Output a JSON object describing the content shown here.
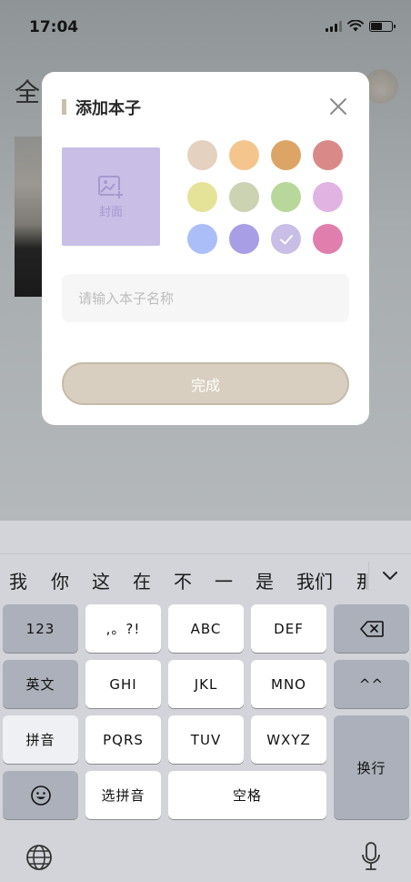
{
  "status_bar": {
    "time": "17:04"
  },
  "background": {
    "title": "全"
  },
  "modal": {
    "title": "添加本子",
    "cover_label": "封面",
    "colors": [
      {
        "hex": "#e5d1c0",
        "selected": false
      },
      {
        "hex": "#f4c68e",
        "selected": false
      },
      {
        "hex": "#dca565",
        "selected": false
      },
      {
        "hex": "#d98a88",
        "selected": false
      },
      {
        "hex": "#e5e398",
        "selected": false
      },
      {
        "hex": "#cbd3b2",
        "selected": false
      },
      {
        "hex": "#b7d89a",
        "selected": false
      },
      {
        "hex": "#e0b3e3",
        "selected": false
      },
      {
        "hex": "#acbef8",
        "selected": false
      },
      {
        "hex": "#a89ee6",
        "selected": false
      },
      {
        "hex": "#c8bee6",
        "selected": true
      },
      {
        "hex": "#e07fae",
        "selected": false
      }
    ],
    "input_value": "",
    "input_placeholder": "请输入本子名称",
    "done_label": "完成"
  },
  "keyboard": {
    "candidates": [
      "我",
      "你",
      "这",
      "在",
      "不",
      "一",
      "是",
      "我们",
      "那"
    ],
    "keys": {
      "num": "123",
      "punct": ",。?!",
      "abc": "ABC",
      "def": "DEF",
      "english": "英文",
      "ghi": "GHI",
      "jkl": "JKL",
      "mno": "MNO",
      "emoticon": "^^",
      "pinyin": "拼音",
      "pqrs": "PQRS",
      "tuv": "TUV",
      "wxyz": "WXYZ",
      "return": "换行",
      "select_pinyin": "选拼音",
      "space": "空格"
    }
  }
}
